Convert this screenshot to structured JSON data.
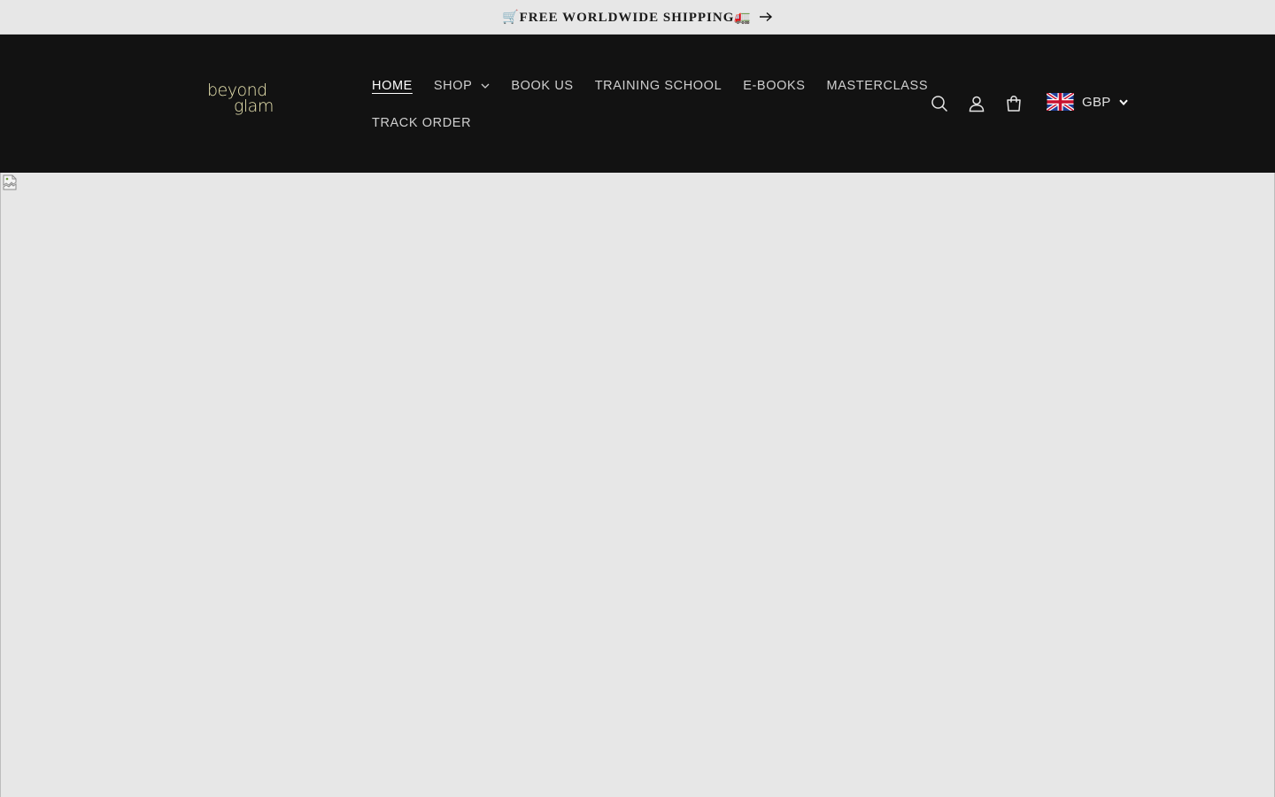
{
  "announcement": {
    "text": "🛒FREE WORLDWIDE SHIPPING🚛",
    "arrow_icon": "arrow-right-icon"
  },
  "header": {
    "logo": {
      "line1": "beyond",
      "line2": "glam",
      "color": "#e9e4b0"
    },
    "nav": {
      "row1": [
        {
          "label": "HOME",
          "active": true
        },
        {
          "label": "SHOP",
          "has_dropdown": true
        },
        {
          "label": "BOOK US"
        },
        {
          "label": "TRAINING SCHOOL"
        },
        {
          "label": "E-BOOKS"
        },
        {
          "label": "MASTERCLASS"
        }
      ],
      "row2": [
        {
          "label": "TRACK ORDER"
        }
      ]
    },
    "icons": [
      "search-icon",
      "account-icon",
      "cart-icon"
    ],
    "currency": {
      "code": "GBP",
      "flag": "uk-flag-icon"
    },
    "background": "#121212"
  },
  "hero": {
    "image": "broken-image-icon",
    "background": "#e7e7e7"
  }
}
